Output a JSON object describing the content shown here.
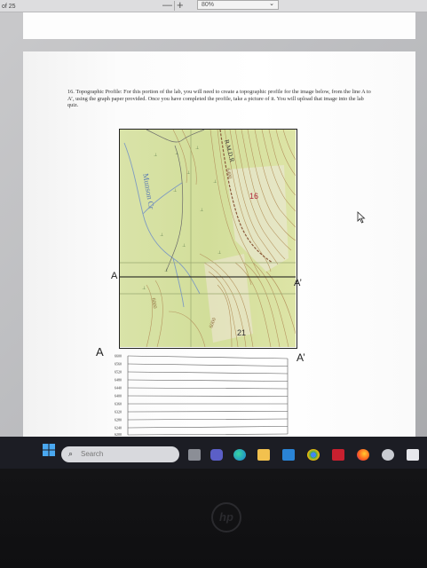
{
  "toolbar": {
    "page_count": "of 25",
    "zoom_minus": "—",
    "zoom_plus": "+",
    "zoom_value": "80%",
    "zoom_caret": "⌄"
  },
  "document": {
    "instructions": "16. Topographic Profile: For this portion of the lab, you will need to create a topographic profile for the image below, from the line A to A’, using the graph paper provided. Once you have completed the profile, take a picture of it. You will upload that image into the lab quiz.",
    "map": {
      "creek_label": "Munson Cr",
      "road_label": "R.M.D.R",
      "contour_label_top": "6400",
      "contour_label_left": "6000",
      "contour_label_bottom": "6000",
      "section_16": "16",
      "section_21": "21",
      "point_a": "A",
      "point_a_prime": "A’"
    },
    "graph": {
      "label_left": "A",
      "label_right": "A’",
      "elevations": [
        "6600",
        "6560",
        "6520",
        "6480",
        "6440",
        "6400",
        "6360",
        "6320",
        "6280",
        "6240",
        "6200"
      ]
    }
  },
  "taskbar": {
    "search_placeholder": "Search",
    "icons": [
      "windows-start-icon",
      "search-icon",
      "task-view-icon",
      "teams-icon",
      "edge-icon",
      "file-explorer-icon",
      "monitor-icon",
      "chrome-icon",
      "mcafee-icon",
      "firefox-icon",
      "steam-icon",
      "app-icon"
    ]
  },
  "device": {
    "logo": "hp"
  }
}
